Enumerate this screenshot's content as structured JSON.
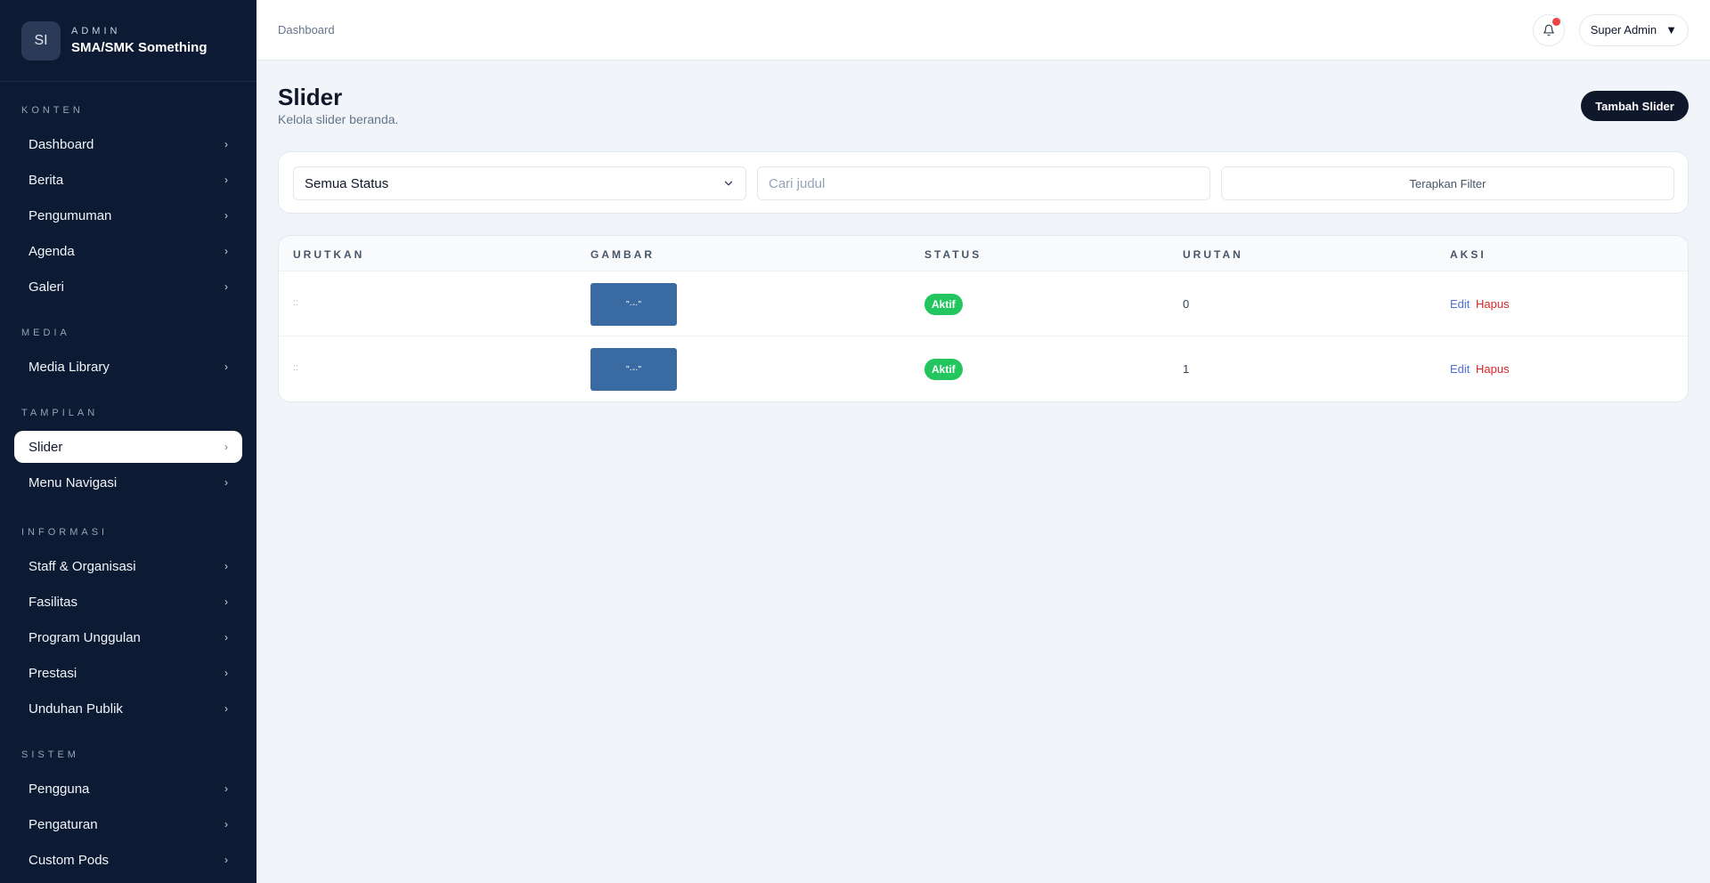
{
  "brand": {
    "avatar": "SI",
    "kicker": "ADMIN",
    "name": "SMA/SMK Something"
  },
  "sidebar": {
    "sections": [
      {
        "title": "KONTEN",
        "items": [
          {
            "label": "Dashboard"
          },
          {
            "label": "Berita"
          },
          {
            "label": "Pengumuman"
          },
          {
            "label": "Agenda"
          },
          {
            "label": "Galeri"
          }
        ]
      },
      {
        "title": "MEDIA",
        "items": [
          {
            "label": "Media Library"
          }
        ]
      },
      {
        "title": "TAMPILAN",
        "items": [
          {
            "label": "Slider",
            "active": true
          },
          {
            "label": "Menu Navigasi"
          }
        ]
      },
      {
        "title": "INFORMASI",
        "items": [
          {
            "label": "Staff & Organisasi"
          },
          {
            "label": "Fasilitas"
          },
          {
            "label": "Program Unggulan"
          },
          {
            "label": "Prestasi"
          },
          {
            "label": "Unduhan Publik"
          }
        ]
      },
      {
        "title": "SISTEM",
        "items": [
          {
            "label": "Pengguna"
          },
          {
            "label": "Pengaturan"
          },
          {
            "label": "Custom Pods"
          }
        ]
      }
    ],
    "chevron_icon": "chevron-right-icon"
  },
  "header": {
    "breadcrumb": "Dashboard",
    "user_label": "Super Admin",
    "user_caret": "▼"
  },
  "page": {
    "title": "Slider",
    "subtitle": "Kelola slider beranda.",
    "add_button": "Tambah Slider"
  },
  "filters": {
    "status_selected": "Semua Status",
    "search_placeholder": "Cari judul",
    "apply_label": "Terapkan Filter"
  },
  "table": {
    "columns": [
      "URUTKAN",
      "GAMBAR",
      "STATUS",
      "URUTAN",
      "AKSI"
    ],
    "rows": [
      {
        "handle": "::",
        "thumb_text": "\"·-·\"",
        "status": "Aktif",
        "order": "0",
        "edit": "Edit",
        "delete": "Hapus"
      },
      {
        "handle": "::",
        "thumb_text": "\"·-·\"",
        "status": "Aktif",
        "order": "1",
        "edit": "Edit",
        "delete": "Hapus"
      }
    ]
  },
  "colors": {
    "sidebar_bg": "#0c1a33",
    "primary": "#0f172a",
    "success": "#22c55e",
    "danger": "#dc2626",
    "link": "#4f6fdc",
    "notification_dot": "#ef4444",
    "thumb": "#3a6aa2"
  }
}
